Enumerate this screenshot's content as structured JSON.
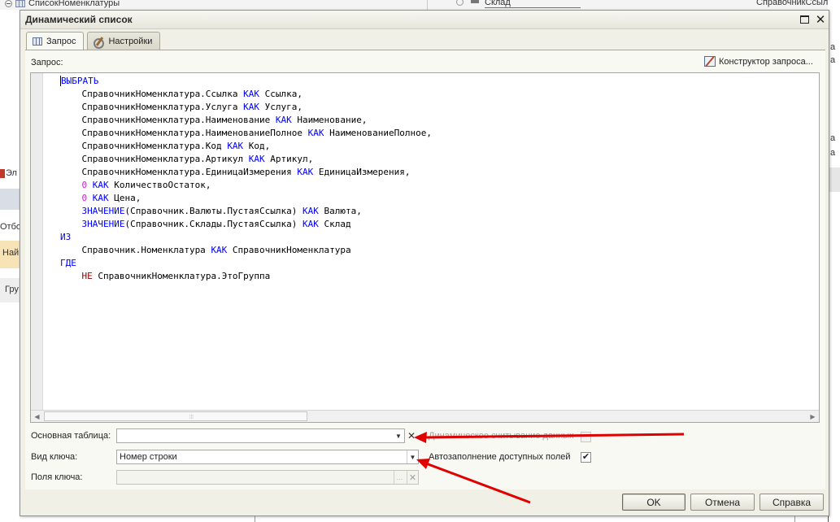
{
  "background": {
    "tree_node_label": "СписокНоменклатуры",
    "sklad_label": "Склад",
    "right_top_text": "СправочникСсылка",
    "left_fragments": [
      "Эл",
      "Отбо",
      "Най",
      "Гру"
    ],
    "right_fragments": [
      "а",
      "а",
      "а",
      "а",
      "а",
      "а"
    ]
  },
  "dialog": {
    "title": "Динамический список",
    "tabs": [
      {
        "label": "Запрос",
        "icon": "table-icon",
        "active": true
      },
      {
        "label": "Настройки",
        "icon": "settings-icon",
        "active": false
      }
    ],
    "query_label": "Запрос:",
    "constructor_button": "Конструктор запроса...",
    "query_lines": [
      "ВЫБРАТЬ",
      "    СправочникНоменклатура.Ссылка КАК Ссылка,",
      "    СправочникНоменклатура.Услуга КАК Услуга,",
      "    СправочникНоменклатура.Наименование КАК Наименование,",
      "    СправочникНоменклатура.НаименованиеПолное КАК НаименованиеПолное,",
      "    СправочникНоменклатура.Код КАК Код,",
      "    СправочникНоменклатура.Артикул КАК Артикул,",
      "    СправочникНоменклатура.ЕдиницаИзмерения КАК ЕдиницаИзмерения,",
      "    0 КАК КоличествоОстаток,",
      "    0 КАК Цена,",
      "    ЗНАЧЕНИЕ(Справочник.Валюты.ПустаяСсылка) КАК Валюта,",
      "    ЗНАЧЕНИЕ(Справочник.Склады.ПустаяСсылка) КАК Склад",
      "ИЗ",
      "    Справочник.Номенклатура КАК СправочникНоменклатура",
      "ГДЕ",
      "    НЕ СправочникНоменклатура.ЭтоГруппа"
    ],
    "main_table": {
      "label": "Основная таблица:",
      "value": ""
    },
    "dynamic_read": {
      "label": "Динамическое считывание данных",
      "checked": false,
      "enabled": false
    },
    "key_type": {
      "label": "Вид ключа:",
      "value": "Номер строки"
    },
    "autofill": {
      "label": "Автозаполнение доступных полей",
      "checked": true,
      "check_glyph": "✔"
    },
    "key_fields": {
      "label": "Поля ключа:",
      "value": ""
    },
    "buttons": {
      "ok": "OK",
      "cancel": "Отмена",
      "help": "Справка"
    }
  },
  "colors": {
    "keyword": "#0000ff",
    "number": "#ff00ff",
    "not_keyword": "#8b0000",
    "annotation_arrow": "#e00000",
    "dialog_background": "#f1f0e6"
  }
}
